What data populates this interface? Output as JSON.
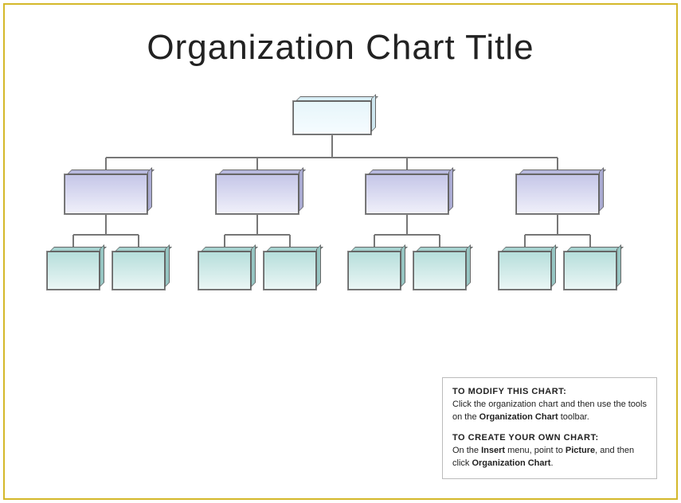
{
  "title": "Organization Chart Title",
  "chart_data": {
    "type": "org_chart",
    "root": {
      "label": ""
    },
    "level2": [
      {
        "label": ""
      },
      {
        "label": ""
      },
      {
        "label": ""
      },
      {
        "label": ""
      }
    ],
    "level3": [
      {
        "label": ""
      },
      {
        "label": ""
      },
      {
        "label": ""
      },
      {
        "label": ""
      },
      {
        "label": ""
      },
      {
        "label": ""
      },
      {
        "label": ""
      },
      {
        "label": ""
      }
    ]
  },
  "instructions": {
    "modify_header": "TO MODIFY THIS CHART:",
    "modify_body_pre": "Click the organization chart and then use the tools on the ",
    "modify_body_bold": "Organization Chart",
    "modify_body_post": " toolbar.",
    "create_header": "TO CREATE YOUR OWN CHART:",
    "create_body_pre": "On the ",
    "create_body_bold1": "Insert",
    "create_body_mid": " menu, point to ",
    "create_body_bold2": "Picture",
    "create_body_mid2": ", and then click ",
    "create_body_bold3": "Organization Chart",
    "create_body_post": "."
  }
}
